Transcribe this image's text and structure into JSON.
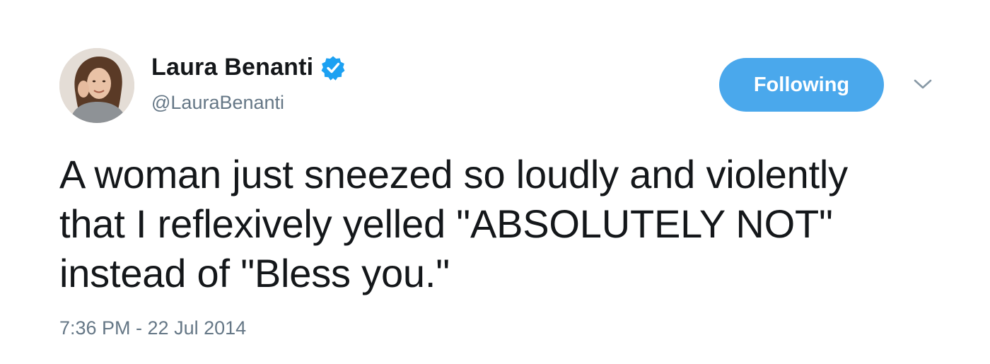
{
  "tweet": {
    "author": {
      "display_name": "Laura Benanti",
      "handle": "@LauraBenanti",
      "verified": true,
      "avatar_icon": "profile-photo"
    },
    "follow_button_label": "Following",
    "menu_icon": "chevron-down-icon",
    "text": "A woman just sneezed so loudly and violently\nthat I reflexively yelled \"ABSOLUTELY NOT\"\ninstead of \"Bless you.\"",
    "timestamp": "7:36 PM - 22 Jul 2014"
  },
  "colors": {
    "accent": "#4aa8ec",
    "verified_badge": "#1da1f2",
    "secondary_text": "#657786",
    "primary_text": "#14171a"
  }
}
